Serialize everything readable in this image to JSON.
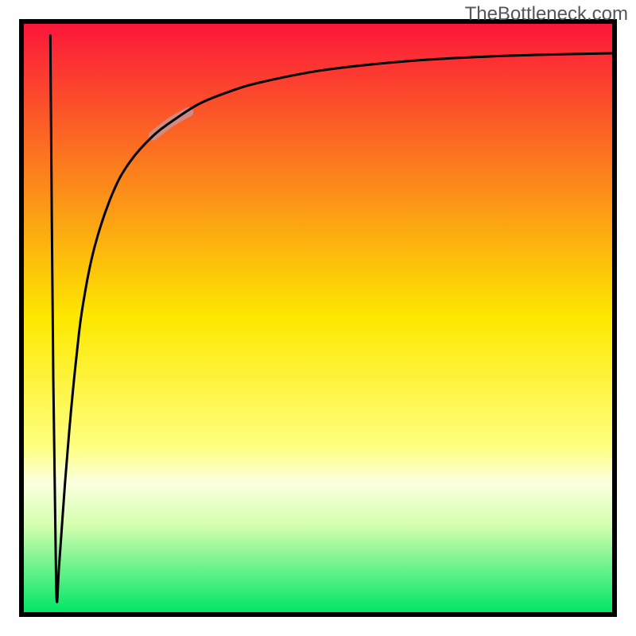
{
  "watermark": {
    "text": "TheBottleneck.com"
  },
  "chart_data": {
    "type": "line",
    "title": "",
    "xlabel": "",
    "ylabel": "",
    "xlim": [
      0,
      100
    ],
    "ylim": [
      0,
      100
    ],
    "axes_visible": false,
    "grid": false,
    "legend": false,
    "background_gradient": {
      "direction": "vertical",
      "stops": [
        {
          "offset": 0.0,
          "color": "#fc163a"
        },
        {
          "offset": 0.5,
          "color": "#fde800"
        },
        {
          "offset": 0.72,
          "color": "#feff80"
        },
        {
          "offset": 0.78,
          "color": "#fbffe0"
        },
        {
          "offset": 0.85,
          "color": "#d6ffb0"
        },
        {
          "offset": 1.0,
          "color": "#00e665"
        }
      ]
    },
    "border": {
      "left": true,
      "top": true,
      "right": true,
      "bottom": true,
      "color": "#000000",
      "width": 6
    },
    "series": [
      {
        "name": "bottleneck-curve",
        "color": "#000000",
        "stroke_width": 3,
        "x": [
          4.5,
          5.0,
          5.5,
          6.0,
          7.0,
          8.0,
          9.0,
          10.0,
          12.0,
          15.0,
          18.0,
          22.0,
          26.0,
          30.0,
          35.0,
          40.0,
          50.0,
          60.0,
          70.0,
          80.0,
          90.0,
          100.0
        ],
        "y": [
          98.0,
          40.0,
          4.0,
          8.0,
          22.0,
          34.0,
          44.0,
          52.0,
          62.0,
          71.0,
          76.5,
          81.0,
          84.0,
          86.5,
          88.5,
          90.0,
          92.0,
          93.2,
          94.0,
          94.5,
          94.8,
          95.0
        ]
      }
    ],
    "highlight": {
      "name": "highlight-band",
      "color": "#c99393",
      "opacity": 0.85,
      "stroke_width": 12,
      "x": [
        22.0,
        23.5,
        25.0,
        26.5,
        28.0
      ],
      "y": [
        81.0,
        82.2,
        83.3,
        84.2,
        85.0
      ]
    }
  }
}
